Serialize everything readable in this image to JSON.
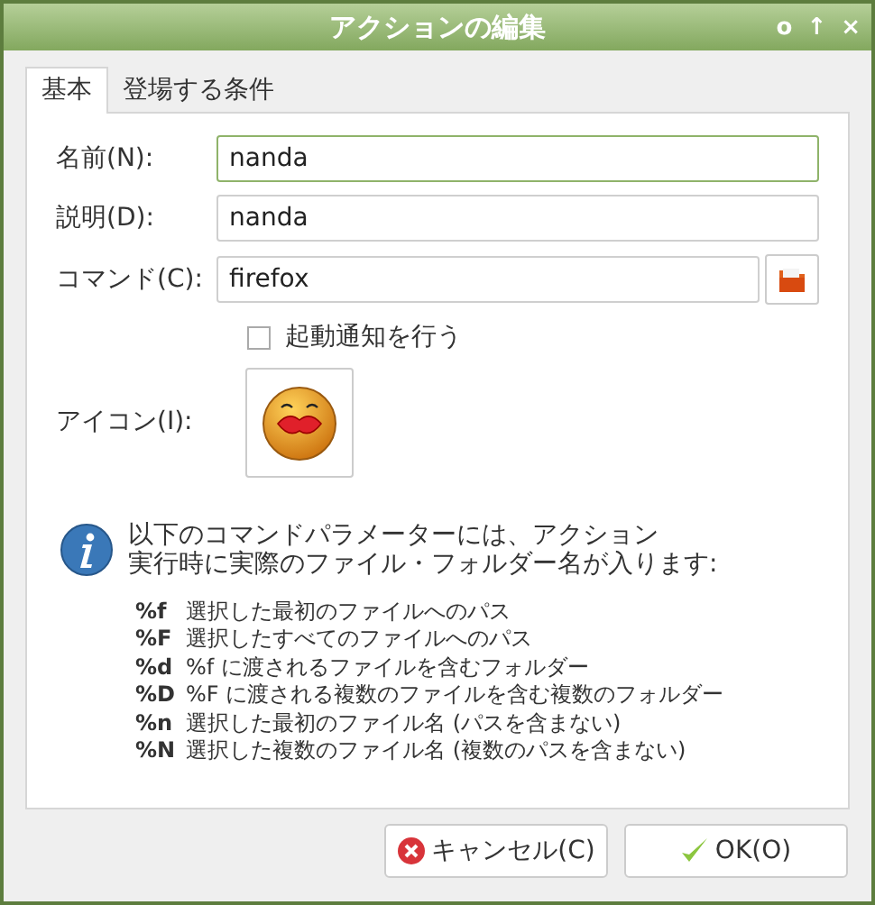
{
  "window": {
    "title": "アクションの編集",
    "controls": [
      "o",
      "↑",
      "×"
    ]
  },
  "tabs": [
    {
      "label": "基本",
      "selected": true
    },
    {
      "label": "登場する条件",
      "selected": false
    }
  ],
  "fields": [
    {
      "label": "名前(N):",
      "value": "nanda",
      "focused": true
    },
    {
      "label": "説明(D):",
      "value": "nanda",
      "focused": false
    },
    {
      "label": "コマンド(C):",
      "value": "firefox",
      "focused": false
    }
  ],
  "startup_notify": {
    "label": "起動通知を行う",
    "checked": false
  },
  "icon": {
    "label": "アイコン(I):"
  },
  "info": {
    "lines": [
      "以下のコマンドパラメーターには、アクション",
      "実行時に実際のファイル・フォルダー名が入ります:"
    ],
    "params": [
      {
        "code": "%f",
        "description": "選択した最初のファイルへのパス"
      },
      {
        "code": "%F",
        "description": "選択したすべてのファイルへのパス"
      },
      {
        "code": "%d",
        "description": "%f に渡されるファイルを含むフォルダー"
      },
      {
        "code": "%D",
        "description": "%F に渡される複数のファイルを含む複数のフォルダー"
      },
      {
        "code": "%n",
        "description": "選択した最初のファイル名 (パスを含まない)"
      },
      {
        "code": "%N",
        "description": "選択した複数のファイル名 (複数のパスを含まない)"
      }
    ]
  },
  "buttons": [
    {
      "label": "キャンセル(C)",
      "kind": "cancel"
    },
    {
      "label": "OK(O)",
      "kind": "ok"
    }
  ]
}
